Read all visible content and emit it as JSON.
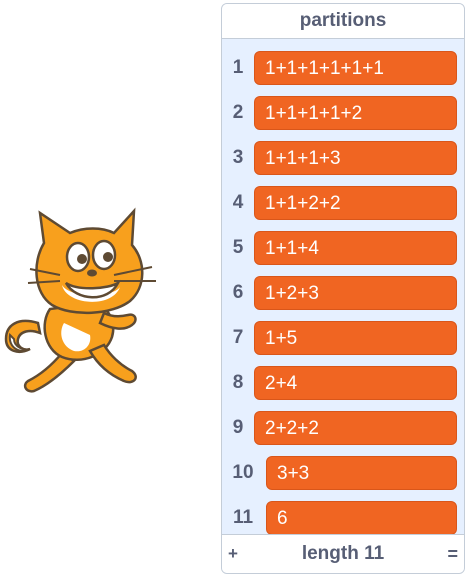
{
  "list": {
    "title": "partitions",
    "items": [
      {
        "index": "1",
        "value": "1+1+1+1+1+1"
      },
      {
        "index": "2",
        "value": "1+1+1+1+2"
      },
      {
        "index": "3",
        "value": "1+1+1+3"
      },
      {
        "index": "4",
        "value": "1+1+2+2"
      },
      {
        "index": "5",
        "value": "1+1+4"
      },
      {
        "index": "6",
        "value": "1+2+3"
      },
      {
        "index": "7",
        "value": "1+5"
      },
      {
        "index": "8",
        "value": "2+4"
      },
      {
        "index": "9",
        "value": "2+2+2"
      },
      {
        "index": "10",
        "value": "3+3"
      },
      {
        "index": "11",
        "value": "6"
      }
    ],
    "footer": {
      "add_label": "+",
      "length_label": "length 11",
      "resize_label": "="
    }
  },
  "sprite": {
    "icon": "scratch-cat-icon"
  },
  "colors": {
    "item_bg": "#f06522",
    "monitor_bg": "#e6f0ff",
    "text": "#575e75"
  }
}
